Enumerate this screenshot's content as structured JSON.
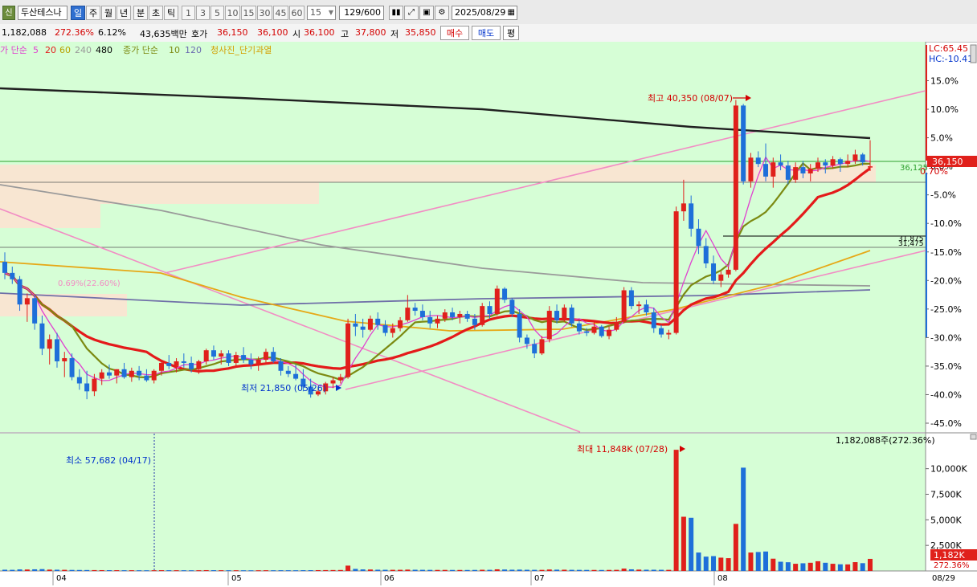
{
  "toolbar": {
    "code_badge": "신",
    "stock_name": "두산테스나",
    "periods": [
      "일",
      "주",
      "월",
      "년",
      "분",
      "초",
      "틱"
    ],
    "intervals": [
      "1",
      "3",
      "5",
      "10",
      "15",
      "30",
      "45",
      "60"
    ],
    "interval_select": "15",
    "count": "129/600",
    "date": "2025/08/29"
  },
  "quote": {
    "volume": "1,182,088",
    "volume_ratio": "272.36%",
    "turnover": "6.12%",
    "amount": "43,635백만",
    "ask_label": "호가",
    "ask1": "36,150",
    "ask2": "36,100",
    "open_label": "시",
    "open": "36,100",
    "high_label": "고",
    "high": "37,800",
    "low_label": "저",
    "low": "35,850",
    "buy_label": "매수",
    "sell_label": "매도",
    "flat_label": "평"
  },
  "legend": {
    "prefix": "가 단순",
    "p5": "5",
    "p20": "20",
    "p60": "60",
    "p240": "240",
    "p480": "480",
    "vol_prefix": "종가 단순",
    "v10": "10",
    "v120": "120",
    "signal": "청사진_단기과열"
  },
  "right_info": {
    "lc": "LC:65.45",
    "hc": "HC:-10.41",
    "price_tag": "36,150",
    "price_pct": "0.70%",
    "line_label": "36,125",
    "level_label1": "31,875",
    "level_label2": "31,475",
    "volume_tag": "1,182K",
    "volume_pct": "272.36%"
  },
  "annotations": {
    "high": "최고 40,350 (08/07)",
    "low": "최저 21,850 (05/26)",
    "ma_label": "0.69%(22.60%)",
    "vol_max": "최대 11,848K (07/28)",
    "vol_min": "최소 57,682 (04/17)",
    "vol_current": "1,182,088주(272.36%)"
  },
  "colors": {
    "up": "#e0201b",
    "down": "#1e6fd9",
    "background": "#d6fed6",
    "ma5": "#e040d0",
    "ma20": "#e41a1a",
    "ma60": "#7c8a12",
    "ma240": "#e6a817",
    "ma480": "#202020"
  },
  "chart_data": {
    "type": "candlestick",
    "y_axis_pct_ticks": [
      "15.0%",
      "10.0%",
      "5.0%",
      "0.0%",
      "-5.0%",
      "-10.0%",
      "-15.0%",
      "-20.0%",
      "-25.0%",
      "-30.0%",
      "-35.0%",
      "-40.0%",
      "-45.0%"
    ],
    "y_axis_pct_values": [
      15,
      10,
      5,
      0,
      -5,
      -10,
      -15,
      -20,
      -25,
      -30,
      -35,
      -40,
      -45
    ],
    "volume_ticks": [
      "10,000K",
      "7,500K",
      "5,000K",
      "2,500K"
    ],
    "volume_tick_values": [
      10000,
      7500,
      5000,
      2500
    ],
    "x_month_labels": [
      "04",
      "05",
      "06",
      "07",
      "08",
      "08/29"
    ],
    "candles": [
      [
        30100,
        30700,
        29000,
        29400,
        120
      ],
      [
        29400,
        29800,
        28700,
        29000,
        110
      ],
      [
        29000,
        29200,
        27000,
        27400,
        150
      ],
      [
        27400,
        28100,
        26300,
        27800,
        140
      ],
      [
        27800,
        28000,
        25800,
        26200,
        160
      ],
      [
        26200,
        26700,
        24200,
        24600,
        180
      ],
      [
        24600,
        25500,
        23600,
        25200,
        130
      ],
      [
        25200,
        25600,
        23400,
        23800,
        120
      ],
      [
        23800,
        24400,
        22800,
        24000,
        110
      ],
      [
        24000,
        24300,
        22600,
        22800,
        100
      ],
      [
        22800,
        23300,
        22000,
        22400,
        95
      ],
      [
        22400,
        23200,
        21400,
        21900,
        90
      ],
      [
        21900,
        23000,
        21600,
        22700,
        85
      ],
      [
        22700,
        23300,
        22300,
        23100,
        80
      ],
      [
        23100,
        23600,
        22700,
        22900,
        78
      ],
      [
        22900,
        23300,
        22400,
        23300,
        75
      ],
      [
        23300,
        23700,
        22700,
        22800,
        70
      ],
      [
        22800,
        23400,
        22500,
        23200,
        72
      ],
      [
        23200,
        23500,
        22600,
        22900,
        68
      ],
      [
        22900,
        23300,
        22500,
        22600,
        66
      ],
      [
        22600,
        23300,
        22400,
        23200,
        70
      ],
      [
        23200,
        23800,
        22900,
        23700,
        75
      ],
      [
        23700,
        24200,
        23300,
        23500,
        73
      ],
      [
        23500,
        24000,
        23100,
        23800,
        70
      ],
      [
        23800,
        24300,
        23400,
        23700,
        69
      ],
      [
        23700,
        24100,
        23100,
        23300,
        67
      ],
      [
        23300,
        23900,
        23000,
        23800,
        70
      ],
      [
        23800,
        24600,
        23600,
        24500,
        80
      ],
      [
        24500,
        24800,
        23900,
        24100,
        75
      ],
      [
        24100,
        24500,
        23600,
        24300,
        72
      ],
      [
        24300,
        24500,
        23500,
        23700,
        70
      ],
      [
        23700,
        24400,
        23400,
        24200,
        68
      ],
      [
        24200,
        24700,
        23700,
        23900,
        66
      ],
      [
        23900,
        24300,
        23300,
        23600,
        64
      ],
      [
        23600,
        24100,
        23200,
        23900,
        66
      ],
      [
        23900,
        24600,
        23700,
        24400,
        70
      ],
      [
        24400,
        24700,
        23700,
        23800,
        68
      ],
      [
        23800,
        24000,
        22900,
        23200,
        72
      ],
      [
        23200,
        23500,
        22800,
        23000,
        70
      ],
      [
        23000,
        23600,
        22600,
        22700,
        68
      ],
      [
        22700,
        23300,
        21900,
        22200,
        75
      ],
      [
        22200,
        22700,
        21500,
        21700,
        78
      ],
      [
        21700,
        22100,
        21600,
        21900,
        80
      ],
      [
        21900,
        22500,
        21700,
        22400,
        85
      ],
      [
        22400,
        22800,
        22100,
        22600,
        90
      ],
      [
        22600,
        23000,
        22400,
        22800,
        95
      ],
      [
        22800,
        26500,
        22700,
        26200,
        520
      ],
      [
        26200,
        26800,
        25400,
        26000,
        200
      ],
      [
        26000,
        26500,
        25300,
        25800,
        150
      ],
      [
        25800,
        26700,
        25700,
        26500,
        140
      ],
      [
        26500,
        26900,
        25800,
        26100,
        120
      ],
      [
        26100,
        26400,
        25400,
        25600,
        115
      ],
      [
        25600,
        26200,
        25300,
        25900,
        110
      ],
      [
        25900,
        26600,
        25700,
        26400,
        112
      ],
      [
        26400,
        28000,
        26300,
        27200,
        130
      ],
      [
        27200,
        27500,
        26700,
        27000,
        118
      ],
      [
        27000,
        27400,
        26400,
        26600,
        110
      ],
      [
        26600,
        27000,
        25900,
        26200,
        105
      ],
      [
        26200,
        26700,
        25900,
        26500,
        100
      ],
      [
        26500,
        27100,
        26300,
        26900,
        102
      ],
      [
        26900,
        27200,
        26400,
        26600,
        98
      ],
      [
        26600,
        27000,
        26200,
        26800,
        96
      ],
      [
        26800,
        27000,
        26300,
        26500,
        95
      ],
      [
        26500,
        26800,
        25800,
        26100,
        100
      ],
      [
        26100,
        27500,
        26000,
        27300,
        115
      ],
      [
        27300,
        27600,
        26500,
        26800,
        110
      ],
      [
        26800,
        28600,
        26700,
        28400,
        160
      ],
      [
        28400,
        28500,
        27500,
        27700,
        140
      ],
      [
        27700,
        27800,
        26600,
        26800,
        120
      ],
      [
        26800,
        27100,
        25000,
        25300,
        130
      ],
      [
        25300,
        25500,
        24600,
        24900,
        115
      ],
      [
        24900,
        25200,
        24000,
        24300,
        110
      ],
      [
        24300,
        25400,
        24200,
        25200,
        105
      ],
      [
        25200,
        27300,
        25000,
        27000,
        140
      ],
      [
        27000,
        27400,
        26200,
        26400,
        125
      ],
      [
        26400,
        27400,
        26300,
        27200,
        120
      ],
      [
        27200,
        27400,
        26000,
        26200,
        110
      ],
      [
        26200,
        26400,
        25500,
        25700,
        105
      ],
      [
        25700,
        25900,
        25400,
        25600,
        100
      ],
      [
        25600,
        26300,
        25500,
        26000,
        98
      ],
      [
        26000,
        26100,
        25300,
        25400,
        96
      ],
      [
        25400,
        26000,
        25200,
        25800,
        100
      ],
      [
        25800,
        26600,
        25700,
        26300,
        108
      ],
      [
        26300,
        28500,
        26200,
        28300,
        230
      ],
      [
        28300,
        28500,
        27100,
        27300,
        160
      ],
      [
        27300,
        27600,
        26800,
        27400,
        130
      ],
      [
        27400,
        27700,
        26700,
        26900,
        120
      ],
      [
        26900,
        27200,
        25600,
        25900,
        118
      ],
      [
        25900,
        26100,
        25300,
        25500,
        112
      ],
      [
        25500,
        25800,
        25200,
        25600,
        108
      ],
      [
        25600,
        33600,
        25500,
        33300,
        11848
      ],
      [
        33300,
        35300,
        32700,
        33800,
        5300
      ],
      [
        33800,
        34300,
        31700,
        32200,
        5200
      ],
      [
        32200,
        32800,
        30600,
        31100,
        1800
      ],
      [
        31100,
        31600,
        29700,
        30000,
        1400
      ],
      [
        30000,
        30500,
        28700,
        28900,
        1450
      ],
      [
        28900,
        29500,
        28500,
        29300,
        1300
      ],
      [
        29300,
        29800,
        29100,
        29600,
        1250
      ],
      [
        29600,
        40350,
        29500,
        40000,
        4600
      ],
      [
        40000,
        40100,
        35000,
        35200,
        10100
      ],
      [
        35200,
        37000,
        34800,
        36700,
        1800
      ],
      [
        36700,
        37100,
        36100,
        36300,
        1850
      ],
      [
        36300,
        37600,
        35200,
        35500,
        1900
      ],
      [
        35500,
        36700,
        34800,
        36400,
        1200
      ],
      [
        36400,
        36900,
        35900,
        36200,
        900
      ],
      [
        36200,
        36500,
        35000,
        35300,
        850
      ],
      [
        35300,
        36400,
        35100,
        36100,
        700
      ],
      [
        36100,
        36500,
        35400,
        35700,
        750
      ],
      [
        35700,
        36300,
        35200,
        36000,
        800
      ],
      [
        36000,
        36700,
        35800,
        36400,
        950
      ],
      [
        36400,
        36600,
        35700,
        36200,
        800
      ],
      [
        36200,
        36800,
        36000,
        36600,
        700
      ],
      [
        36600,
        36700,
        35800,
        36300,
        650
      ],
      [
        36300,
        36900,
        36100,
        36500,
        640
      ],
      [
        36500,
        37200,
        36300,
        36900,
        860
      ],
      [
        36900,
        37000,
        36200,
        36400,
        760
      ],
      [
        36100,
        37800,
        35850,
        36150,
        1182
      ]
    ]
  }
}
